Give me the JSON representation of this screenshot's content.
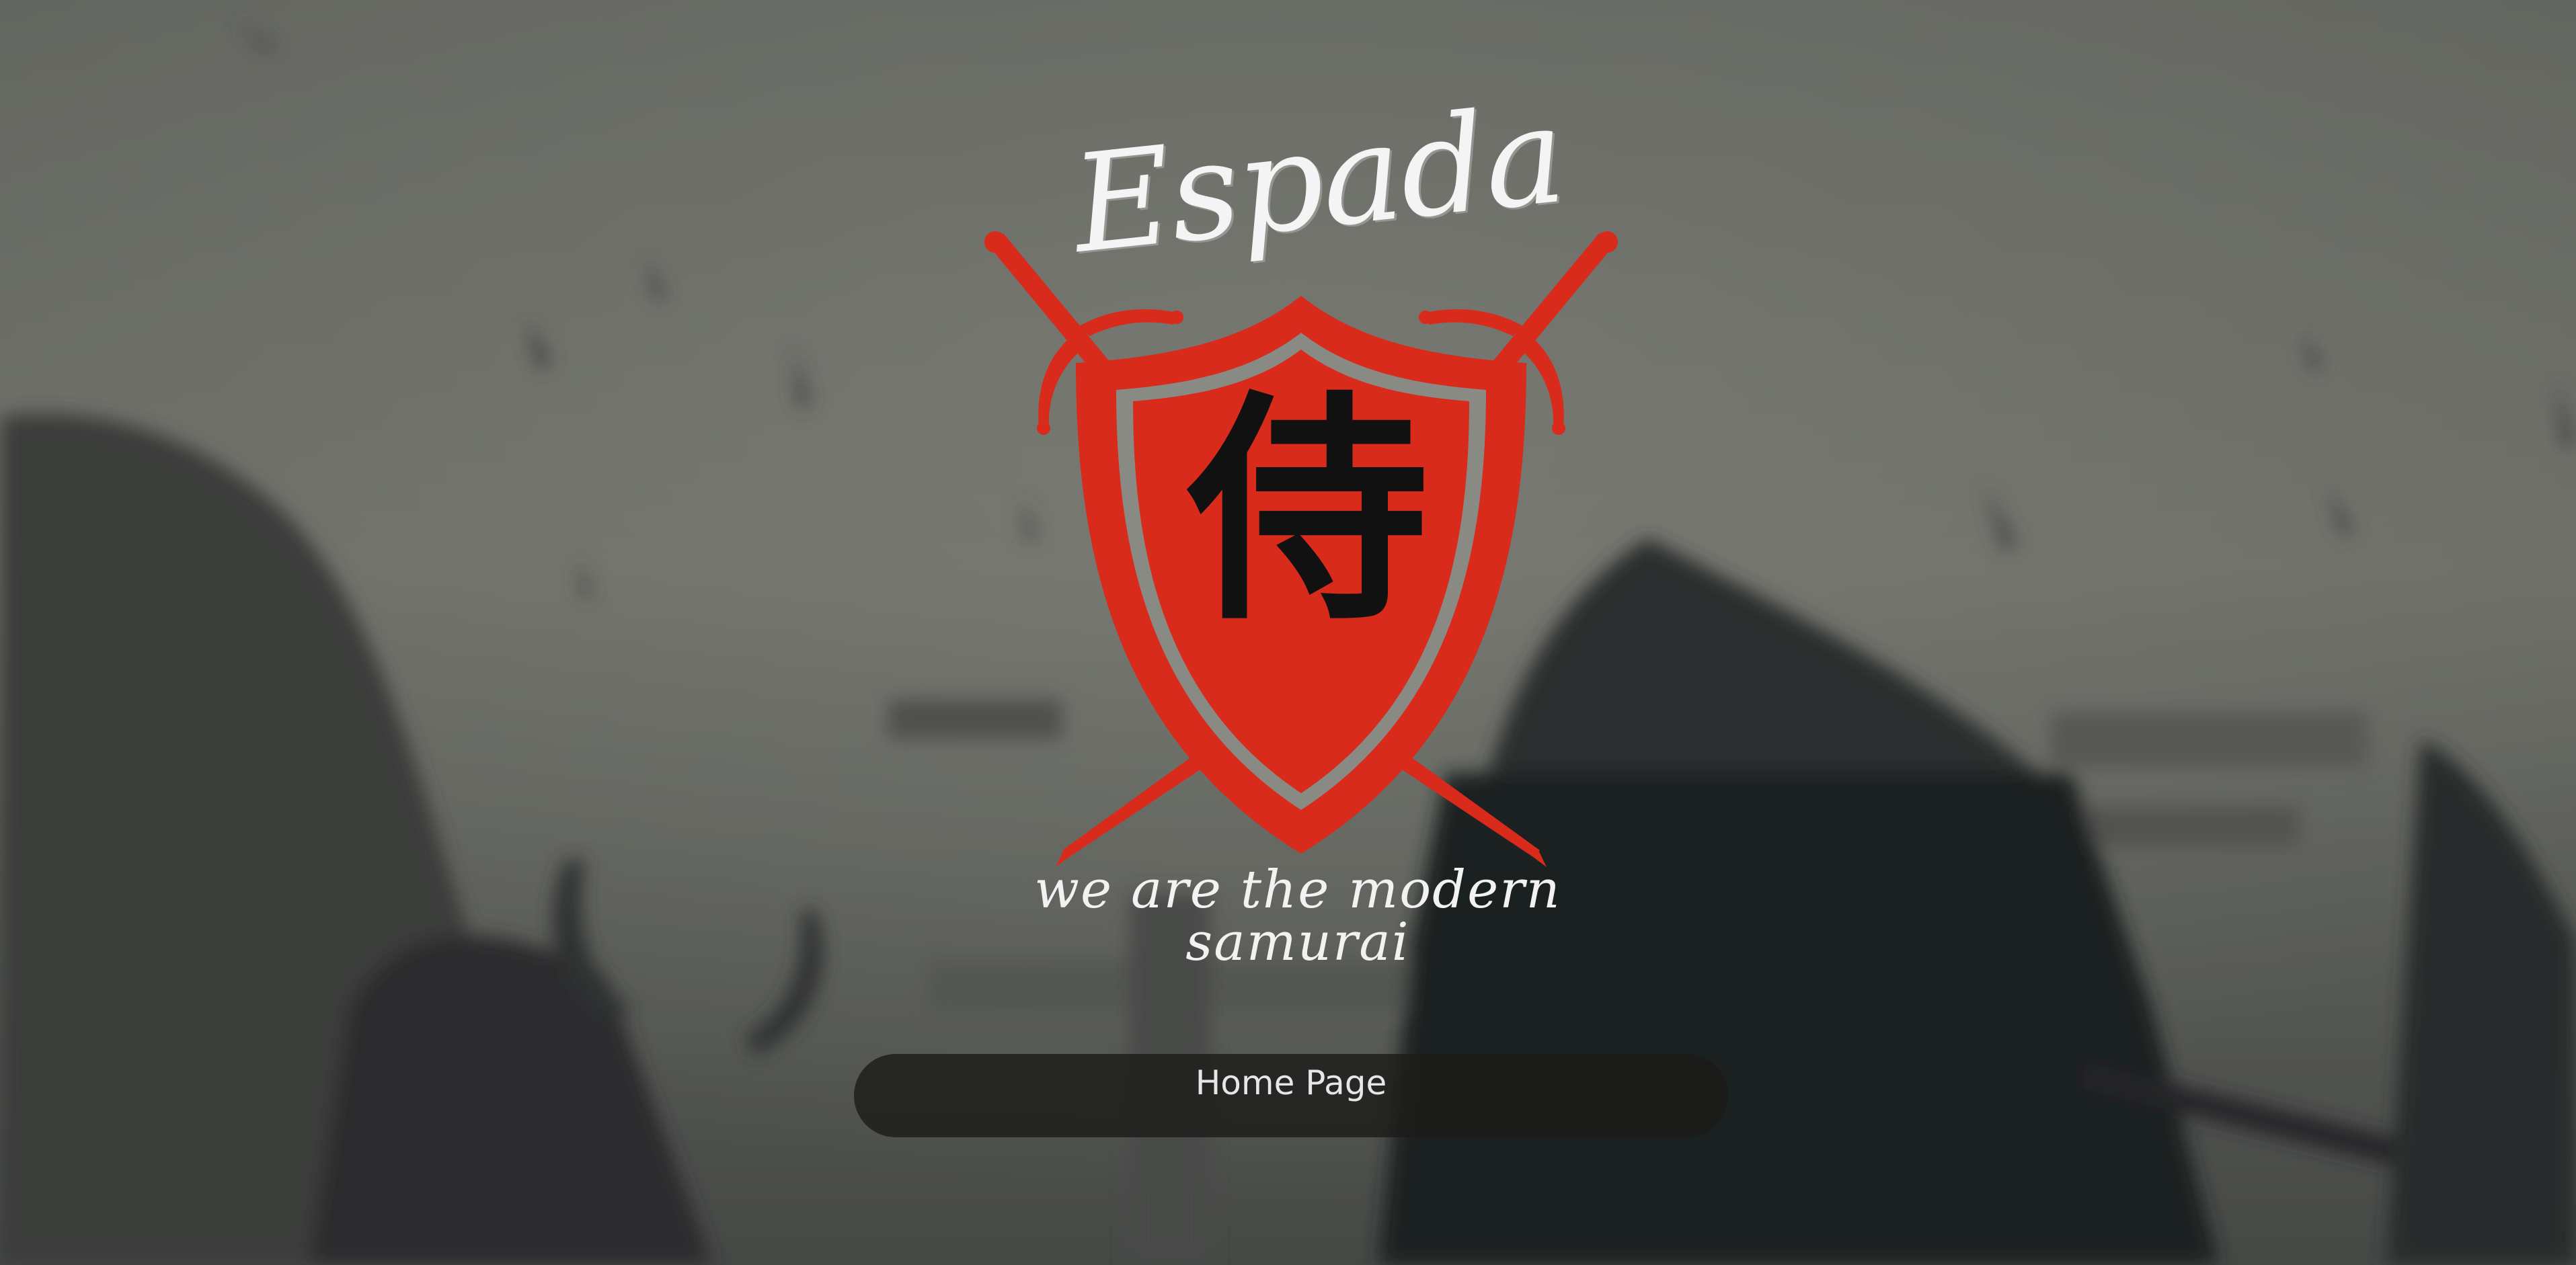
{
  "brand": {
    "name": "Espada",
    "emblem_character": "侍",
    "tagline": "we are the modern samurai"
  },
  "nav": {
    "home_button_label": "Home Page"
  },
  "icons": {
    "logo": "crossed-swords-shield-icon"
  },
  "colors": {
    "brand_red": "#d92b1c",
    "shield_inner_gray": "#8a8a84",
    "button_bg": "#1c1c1a",
    "text_light": "#f4f4f4"
  }
}
